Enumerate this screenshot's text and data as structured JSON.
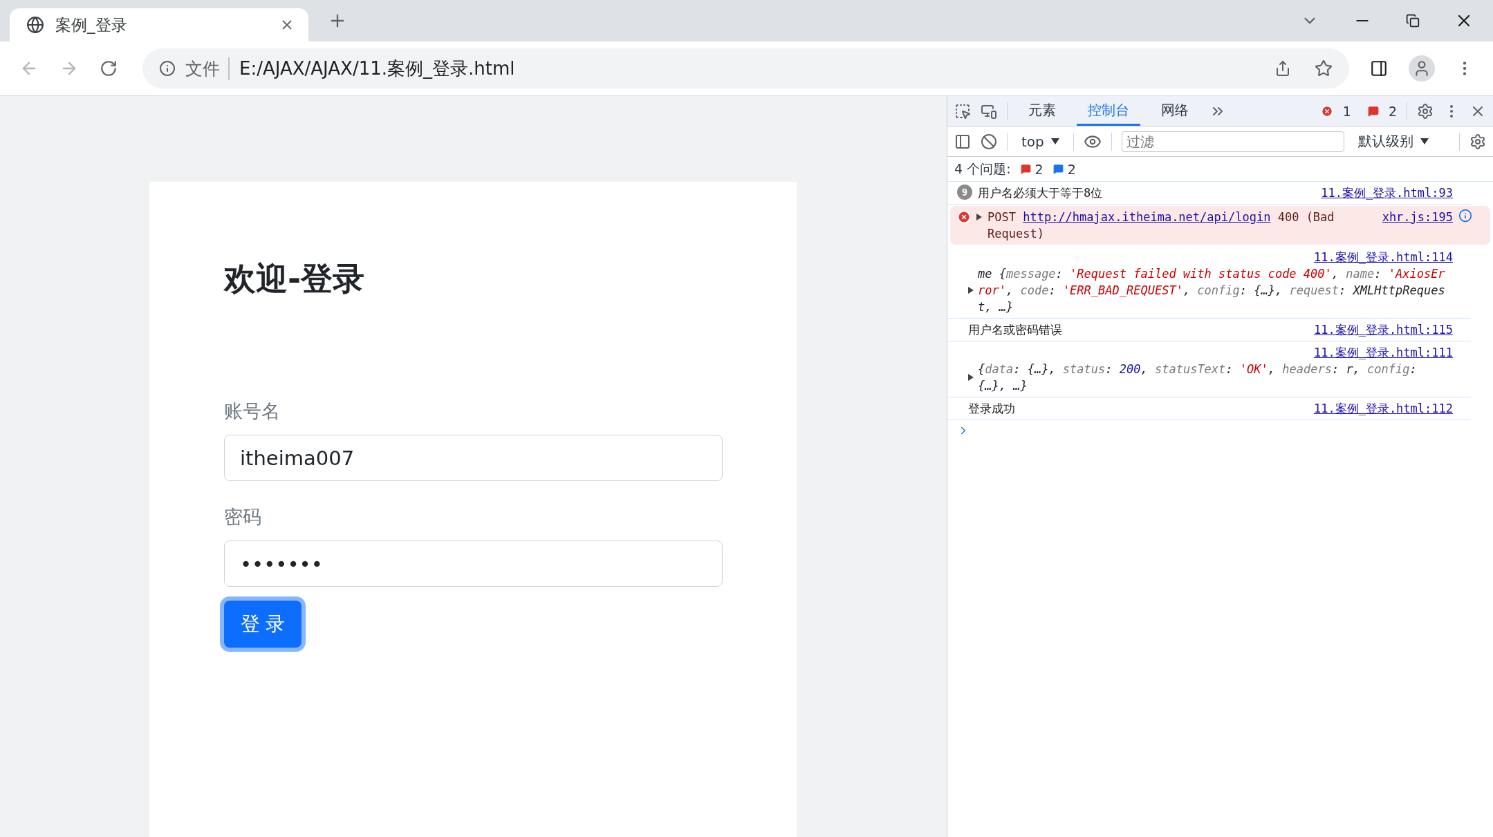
{
  "browser": {
    "tab": {
      "title": "案例_登录"
    },
    "address": {
      "scheme_label": "文件",
      "url": "E:/AJAX/AJAX/11.案例_登录.html"
    }
  },
  "page": {
    "title": "欢迎-登录",
    "fields": [
      {
        "label": "账号名",
        "value": "itheima007"
      },
      {
        "label": "密码",
        "value": "•••••••"
      }
    ],
    "button": {
      "label": "登 录",
      "focused": true
    }
  },
  "devtools": {
    "tabs": [
      {
        "label": "元素",
        "selected": false
      },
      {
        "label": "控制台",
        "selected": true
      },
      {
        "label": "网络",
        "selected": false
      }
    ],
    "error_count": "1",
    "issue_count": "2",
    "context": "top",
    "filter": {
      "placeholder": "过滤"
    },
    "level_menu": "默认级别",
    "issues": {
      "label": "4 个问题:",
      "errors": "2",
      "infos": "2"
    },
    "messages": [
      {
        "kind": "log",
        "count": "9",
        "text": "用户名必须大于等于8位",
        "source": "11.案例_登录.html:93"
      },
      {
        "kind": "error",
        "method": "POST",
        "url": "http://hmajax.itheima.net/api/login",
        "text": "400 (Bad Request)",
        "source": "xhr.js:195"
      },
      {
        "kind": "object",
        "source": "11.案例_登录.html:114",
        "parts": [
          {
            "kind": "plain",
            "text": "me {"
          },
          {
            "kind": "key",
            "text": "message"
          },
          {
            "kind": "plain",
            "text": ": "
          },
          {
            "kind": "string",
            "text": "'Request failed with status code 400'"
          },
          {
            "kind": "plain",
            "text": ", "
          },
          {
            "kind": "key",
            "text": "name"
          },
          {
            "kind": "plain",
            "text": ": "
          },
          {
            "kind": "string",
            "text": "'AxiosError'"
          },
          {
            "kind": "plain",
            "text": ", "
          },
          {
            "kind": "key",
            "text": "code"
          },
          {
            "kind": "plain",
            "text": ": "
          },
          {
            "kind": "string",
            "text": "'ERR_BAD_REQUEST'"
          },
          {
            "kind": "plain",
            "text": ", "
          },
          {
            "kind": "key",
            "text": "config"
          },
          {
            "kind": "plain",
            "text": ": {…}, "
          },
          {
            "kind": "key",
            "text": "request"
          },
          {
            "kind": "plain",
            "text": ": XMLHttpRequest, …}"
          }
        ]
      },
      {
        "kind": "log",
        "text": "用户名或密码错误",
        "source": "11.案例_登录.html:115"
      },
      {
        "kind": "object",
        "source": "11.案例_登录.html:111",
        "parts": [
          {
            "kind": "plain",
            "text": "{"
          },
          {
            "kind": "key",
            "text": "data"
          },
          {
            "kind": "plain",
            "text": ": {…}, "
          },
          {
            "kind": "key",
            "text": "status"
          },
          {
            "kind": "plain",
            "text": ": "
          },
          {
            "kind": "number",
            "text": "200"
          },
          {
            "kind": "plain",
            "text": ", "
          },
          {
            "kind": "key",
            "text": "statusText"
          },
          {
            "kind": "plain",
            "text": ": "
          },
          {
            "kind": "string",
            "text": "'OK'"
          },
          {
            "kind": "plain",
            "text": ", "
          },
          {
            "kind": "key",
            "text": "headers"
          },
          {
            "kind": "plain",
            "text": ": r, "
          },
          {
            "kind": "key",
            "text": "config"
          },
          {
            "kind": "plain",
            "text": ": {…}, …}"
          }
        ]
      },
      {
        "kind": "log",
        "text": "登录成功",
        "source": "11.案例_登录.html:112"
      }
    ]
  }
}
